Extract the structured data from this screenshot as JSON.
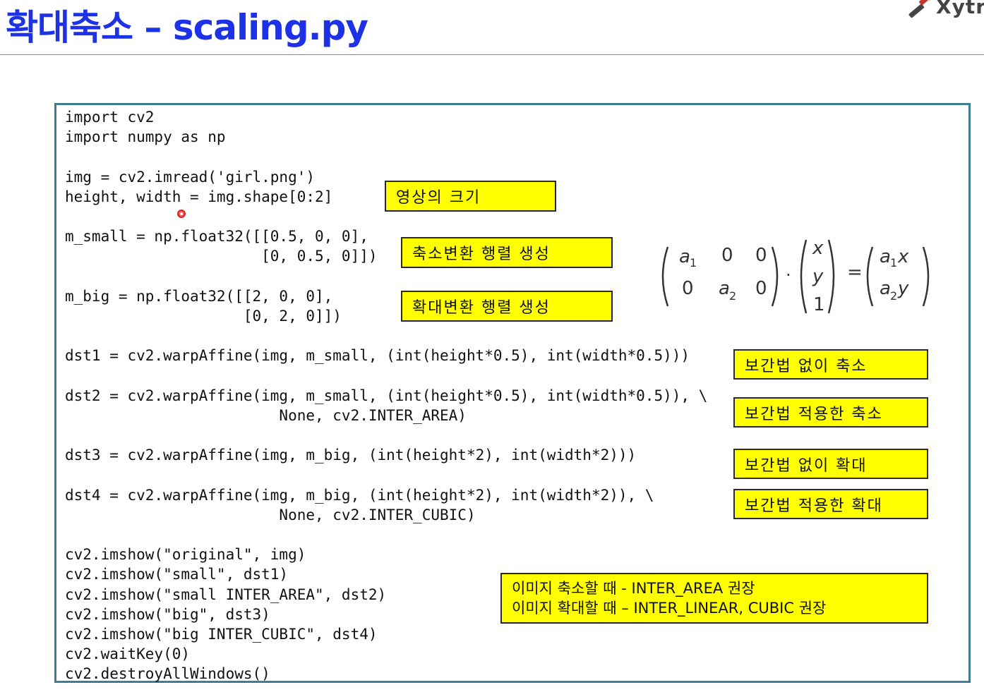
{
  "title": "확대축소 – scaling.py",
  "logo": {
    "text": "Xytr",
    "icon": "wand-icon"
  },
  "code": [
    "import cv2",
    "import numpy as np",
    "",
    "img = cv2.imread('girl.png')",
    "height, width = img.shape[0:2]",
    "",
    "m_small = np.float32([[0.5, 0, 0],",
    "                      [0, 0.5, 0]])",
    "",
    "m_big = np.float32([[2, 0, 0],",
    "                    [0, 2, 0]])",
    "",
    "dst1 = cv2.warpAffine(img, m_small, (int(height*0.5), int(width*0.5)))",
    "",
    "dst2 = cv2.warpAffine(img, m_small, (int(height*0.5), int(width*0.5)), \\",
    "                        None, cv2.INTER_AREA)",
    "",
    "dst3 = cv2.warpAffine(img, m_big, (int(height*2), int(width*2)))",
    "",
    "dst4 = cv2.warpAffine(img, m_big, (int(height*2), int(width*2)), \\",
    "                        None, cv2.INTER_CUBIC)",
    "",
    "cv2.imshow(\"original\", img)",
    "cv2.imshow(\"small\", dst1)",
    "cv2.imshow(\"small INTER_AREA\", dst2)",
    "cv2.imshow(\"big\", dst3)",
    "cv2.imshow(\"big INTER_CUBIC\", dst4)",
    "cv2.waitKey(0)",
    "cv2.destroyAllWindows()"
  ],
  "notes": {
    "size": "영상의 크기",
    "shrink_matrix": "축소변환 행렬 생성",
    "enlarge_matrix": "확대변환 행렬 생성",
    "shrink_no_interp": "보간법 없이 축소",
    "shrink_interp": "보간법 적용한 축소",
    "enlarge_no_interp": "보간법 없이 확대",
    "enlarge_interp": "보간법 적용한 확대",
    "recommend_line1": "이미지 축소할 때 - INTER_AREA 권장",
    "recommend_line2": "이미지 확대할 때 – INTER_LINEAR, CUBIC 권장"
  },
  "formula": {
    "a1": "a",
    "sub1": "1",
    "zero": "0",
    "a2": "a",
    "sub2": "2",
    "x": "x",
    "y": "y",
    "one": "1",
    "dot": "·",
    "eq": "=",
    "r1": "a",
    "r1sub": "1",
    "r1var": "x",
    "r2": "a",
    "r2sub": "2",
    "r2var": "y"
  },
  "colors": {
    "title": "#1d32e6",
    "note_bg": "#ffff00",
    "box_border": "#3d7f8c"
  }
}
